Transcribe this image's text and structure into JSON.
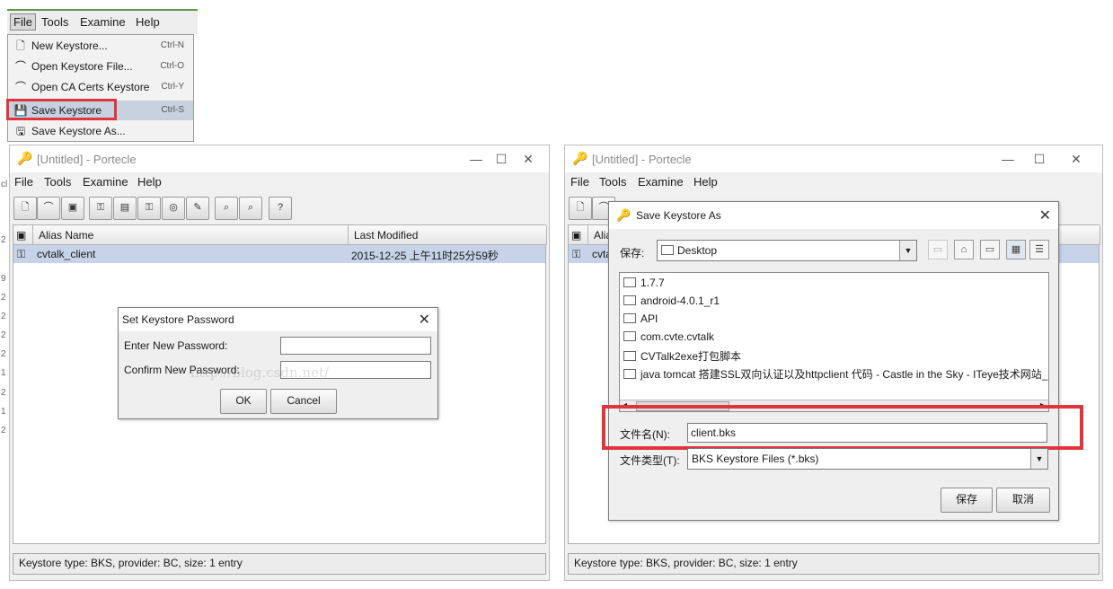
{
  "file_menu": {
    "menubar": [
      "File",
      "Tools",
      "Examine",
      "Help"
    ],
    "items": [
      {
        "icon": "new-keystore-icon",
        "glyph": "🗋",
        "label": "New Keystore...",
        "shortcut": "Ctrl-N"
      },
      {
        "icon": "open-keystore-icon",
        "glyph": "⌒",
        "label": "Open Keystore File...",
        "shortcut": "Ctrl-O"
      },
      {
        "icon": "open-ca-certs-icon",
        "glyph": "⌒",
        "label": "Open CA Certs Keystore",
        "shortcut": "Ctrl-Y"
      },
      {
        "icon": "save-keystore-icon",
        "glyph": "💾",
        "label": "Save Keystore",
        "shortcut": "Ctrl-S"
      },
      {
        "icon": "save-keystore-as-icon",
        "glyph": "🖫",
        "label": "Save Keystore As..."
      }
    ],
    "highlight_color": "#e0353b"
  },
  "window_left": {
    "title": "[Untitled] - Portecle",
    "menubar": [
      "File",
      "Tools",
      "Examine",
      "Help"
    ],
    "table": {
      "columns": [
        "Alias Name",
        "Last Modified"
      ],
      "rows": [
        {
          "alias": "cvtalk_client",
          "modified": "2015-12-25 上午11时25分59秒"
        }
      ]
    },
    "status": "Keystore type: BKS, provider: BC, size: 1 entry",
    "watermark": "http://blog.csdn.net/"
  },
  "password_dialog": {
    "title": "Set Keystore Password",
    "enter_label": "Enter New Password:",
    "confirm_label": "Confirm New Password:",
    "ok": "OK",
    "cancel": "Cancel"
  },
  "window_right": {
    "title": "[Untitled] - Portecle",
    "menubar": [
      "File",
      "Tools",
      "Examine",
      "Help"
    ],
    "table_header_partial": "Alia",
    "row_partial": "cvta",
    "status": "Keystore type: BKS, provider: BC, size: 1 entry"
  },
  "save_dialog": {
    "title": "Save Keystore As",
    "save_in_label": "保存:",
    "save_in_value": "Desktop",
    "files": [
      "1.7.7",
      "android-4.0.1_r1",
      "API",
      "com.cvte.cvtalk",
      "CVTalk2exe打包脚本",
      "java tomcat 搭建SSL双向认证以及httpclient 代码 - Castle in the Sky - ITeye技术网站_"
    ],
    "filename_label": "文件名(N):",
    "filename_value": "client.bks",
    "filetype_label": "文件类型(T):",
    "filetype_value": "BKS Keystore Files (*.bks)",
    "save_button": "保存",
    "cancel_button": "取消"
  },
  "left_edge_fragments": [
    "cl",
    "2",
    "9",
    "2",
    "2",
    "2",
    "2",
    "1",
    "2",
    "1",
    "2"
  ]
}
